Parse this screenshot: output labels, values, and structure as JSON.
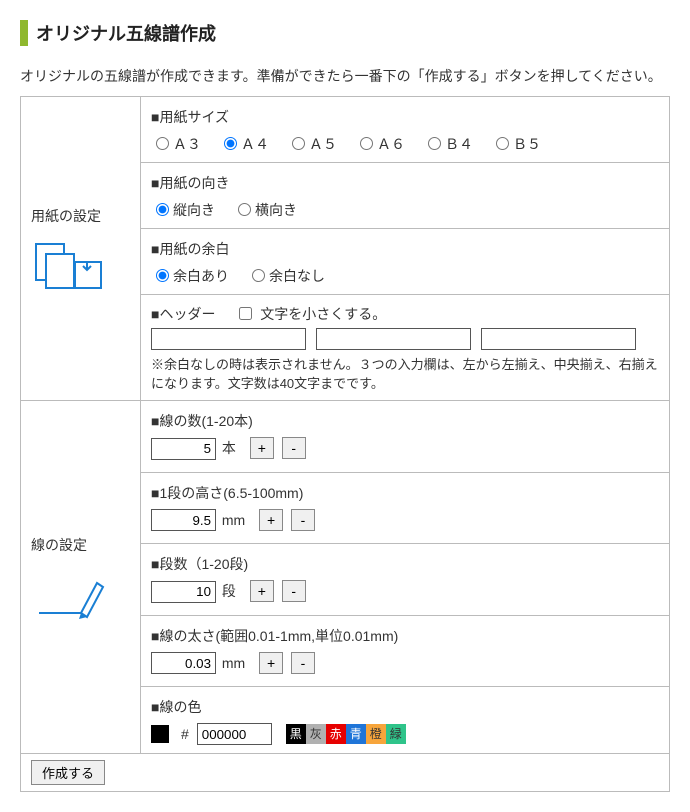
{
  "title": "オリジナル五線譜作成",
  "intro": "オリジナルの五線譜が作成できます。準備ができたら一番下の「作成する」ボタンを押してください。",
  "paper": {
    "section_label": "用紙の設定",
    "size_heading": "■用紙サイズ",
    "sizes": [
      "Ａ３",
      "Ａ４",
      "Ａ５",
      "Ａ６",
      "Ｂ４",
      "Ｂ５"
    ],
    "size_selected": "Ａ４",
    "orient_heading": "■用紙の向き",
    "orients": [
      "縦向き",
      "横向き"
    ],
    "orient_selected": "縦向き",
    "margin_heading": "■用紙の余白",
    "margins": [
      "余白あり",
      "余白なし"
    ],
    "margin_selected": "余白あり",
    "header_label": "■ヘッダー",
    "header_small_label": "文字を小さくする。",
    "header_note": "※余白なしの時は表示されません。３つの入力欄は、左から左揃え、中央揃え、右揃えになります。文字数は40文字までです。"
  },
  "lines": {
    "section_label": "線の設定",
    "count_heading": "■線の数(1-20本)",
    "count_value": "5",
    "count_unit": "本",
    "height_heading": "■1段の高さ(6.5-100mm)",
    "height_value": "9.5",
    "height_unit": "mm",
    "rows_heading": "■段数（1-20段)",
    "rows_value": "10",
    "rows_unit": "段",
    "thick_heading": "■線の太さ(範囲0.01-1mm,単位0.01mm)",
    "thick_value": "0.03",
    "thick_unit": "mm",
    "color_heading": "■線の色",
    "hash": "#",
    "color_value": "000000",
    "palette": [
      {
        "label": "黒",
        "bg": "#000000",
        "fg": "#ffffff"
      },
      {
        "label": "灰",
        "bg": "#b0b0b0",
        "fg": "#333333"
      },
      {
        "label": "赤",
        "bg": "#e60000",
        "fg": "#ffffff"
      },
      {
        "label": "青",
        "bg": "#1f75d8",
        "fg": "#ffffff"
      },
      {
        "label": "橙",
        "bg": "#f7a53b",
        "fg": "#333333"
      },
      {
        "label": "緑",
        "bg": "#2fc48a",
        "fg": "#333333"
      }
    ]
  },
  "buttons": {
    "plus": "+",
    "minus": "-",
    "submit": "作成する"
  }
}
